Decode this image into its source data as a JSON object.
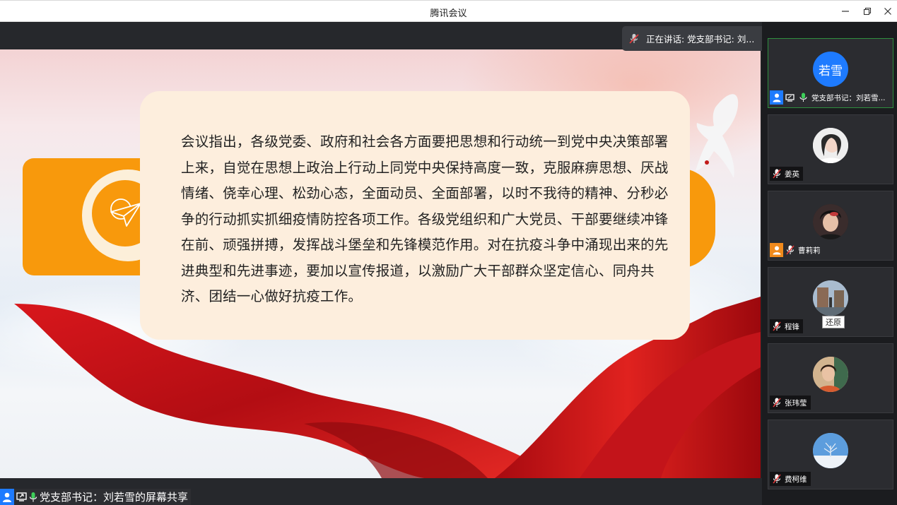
{
  "window": {
    "title": "腾讯会议"
  },
  "speaking": {
    "text": "正在讲话: 党支部书记: 刘..."
  },
  "slide": {
    "paragraph": "会议指出，各级党委、政府和社会各方面要把思想和行动统一到党中央决策部署上来，自觉在思想上政治上行动上同党中央保持高度一致，克服麻痹思想、厌战情绪、侥幸心理、松劲心态，全面动员、全面部署，以时不我待的精神、分秒必争的行动抓实抓细疫情防控各项工作。各级党组织和广大党员、干部要继续冲锋在前、顽强拼搏，发挥战斗堡垒和先锋模范作用。对在抗疫斗争中涌现出来的先进典型和先进事迹，要加以宣传报道，以激励广大干部群众坚定信心、同舟共济、团结一心做好抗疫工作。"
  },
  "share_label": "党支部书记：刘若雪的屏幕共享",
  "participants": [
    {
      "name": "党支部书记：刘若雪...",
      "avatar_text": "若雪",
      "avatar_color": "#1e7bff",
      "host": true,
      "sharing": true,
      "mic": "on"
    },
    {
      "name": "姜英",
      "mic": "off"
    },
    {
      "name": "曹莉莉",
      "mic": "off",
      "cohost": true
    },
    {
      "name": "程锋",
      "mic": "off"
    },
    {
      "name": "张玮莹",
      "mic": "off"
    },
    {
      "name": "费柯维",
      "mic": "off"
    }
  ],
  "tooltip": {
    "restore": "还原"
  },
  "colors": {
    "accent_orange": "#f8990c",
    "card_bg": "#fdeedd",
    "host_blue": "#1e7bff",
    "active_border": "#2f8f3f",
    "mute_red": "#e5393a"
  },
  "icons": [
    "minimize-icon",
    "restore-window-icon",
    "close-icon",
    "mic-muted-icon",
    "undo-icon",
    "paper-plane-icon",
    "user-icon",
    "screen-share-icon",
    "mic-icon"
  ]
}
